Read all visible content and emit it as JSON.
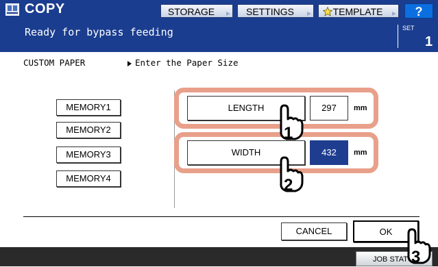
{
  "header": {
    "title": "COPY",
    "buttons": [
      "STORAGE",
      "SETTINGS",
      "TEMPLATE"
    ],
    "help": "?"
  },
  "status": {
    "message": "Ready for bypass feeding",
    "set_label": "SET",
    "set_count": "1"
  },
  "content": {
    "section_title": "CUSTOM PAPER",
    "hint": "Enter the Paper Size",
    "memory_buttons": [
      "MEMORY1",
      "MEMORY2",
      "MEMORY3",
      "MEMORY4"
    ],
    "length": {
      "label": "LENGTH",
      "value": "297",
      "unit": "mm"
    },
    "width": {
      "label": "WIDTH",
      "value": "432",
      "unit": "mm"
    }
  },
  "actions": {
    "cancel": "CANCEL",
    "ok": "OK"
  },
  "footer": {
    "job_status": "JOB STATUS"
  },
  "steps": [
    "1",
    "2",
    "3"
  ],
  "colors": {
    "header_bg": "#1a3d8f",
    "active_field": "#1f3d8f",
    "callout": "#e8a08a",
    "help": "#0b6fe0"
  }
}
